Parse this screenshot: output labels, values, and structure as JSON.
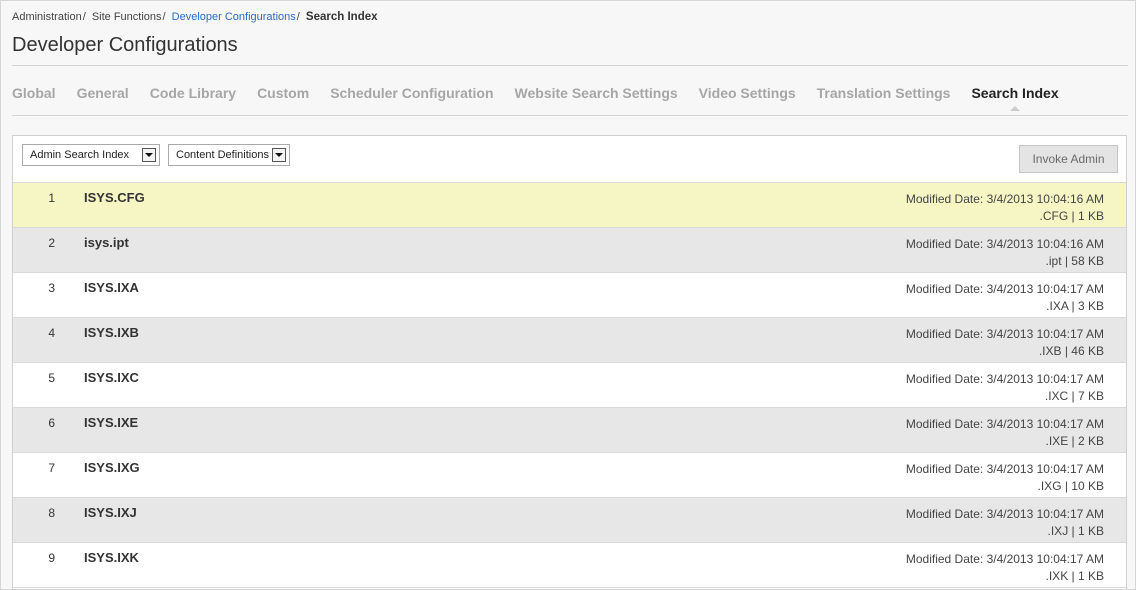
{
  "breadcrumb": {
    "items": [
      {
        "label": "Administration"
      },
      {
        "label": "Site Functions"
      },
      {
        "label": "Developer Configurations"
      }
    ],
    "current": "Search Index",
    "link_color": "#2a6cc4"
  },
  "page": {
    "title": "Developer Configurations"
  },
  "tabs": [
    {
      "label": "Global"
    },
    {
      "label": "General"
    },
    {
      "label": "Code Library"
    },
    {
      "label": "Custom"
    },
    {
      "label": "Scheduler Configuration"
    },
    {
      "label": "Website Search Settings"
    },
    {
      "label": "Video Settings"
    },
    {
      "label": "Translation Settings"
    },
    {
      "label": "Search Index",
      "active": true
    }
  ],
  "toolbar": {
    "index_select": {
      "value": "Admin Search Index",
      "icon": "chevron-down-icon"
    },
    "type_select": {
      "value": "Content Definitions",
      "icon": "chevron-down-icon"
    },
    "invoke_button": "Invoke Admin"
  },
  "files": [
    {
      "num": "1",
      "name": "ISYS.CFG",
      "modified": "Modified Date: 3/4/2013 10:04:16 AM",
      "info": ".CFG | 1 KB",
      "highlight": true
    },
    {
      "num": "2",
      "name": "isys.ipt",
      "modified": "Modified Date: 3/4/2013 10:04:16 AM",
      "info": ".ipt | 58 KB"
    },
    {
      "num": "3",
      "name": "ISYS.IXA",
      "modified": "Modified Date: 3/4/2013 10:04:17 AM",
      "info": ".IXA | 3 KB"
    },
    {
      "num": "4",
      "name": "ISYS.IXB",
      "modified": "Modified Date: 3/4/2013 10:04:17 AM",
      "info": ".IXB | 46 KB"
    },
    {
      "num": "5",
      "name": "ISYS.IXC",
      "modified": "Modified Date: 3/4/2013 10:04:17 AM",
      "info": ".IXC | 7 KB"
    },
    {
      "num": "6",
      "name": "ISYS.IXE",
      "modified": "Modified Date: 3/4/2013 10:04:17 AM",
      "info": ".IXE | 2 KB"
    },
    {
      "num": "7",
      "name": "ISYS.IXG",
      "modified": "Modified Date: 3/4/2013 10:04:17 AM",
      "info": ".IXG | 10 KB"
    },
    {
      "num": "8",
      "name": "ISYS.IXJ",
      "modified": "Modified Date: 3/4/2013 10:04:17 AM",
      "info": ".IXJ | 1 KB"
    },
    {
      "num": "9",
      "name": "ISYS.IXK",
      "modified": "Modified Date: 3/4/2013 10:04:17 AM",
      "info": ".IXK | 1 KB"
    }
  ],
  "colors": {
    "highlight_row": "#f6f5c4",
    "alt_row": "#e7e7e7",
    "inactive_tab": "#a6a6a6",
    "active_tab": "#222222"
  }
}
